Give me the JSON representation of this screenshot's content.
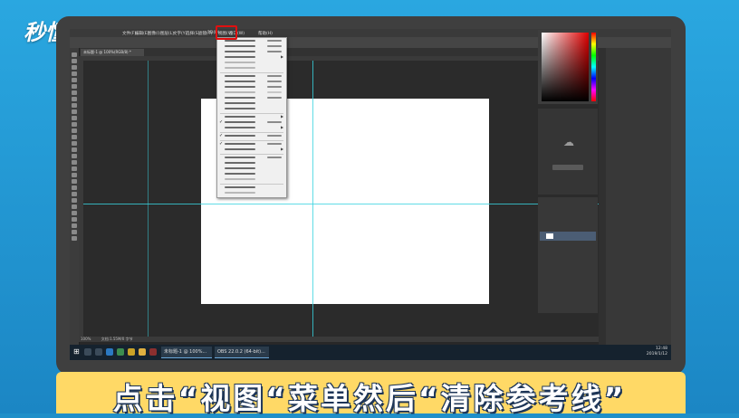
{
  "brand": {
    "logo_text": "秒懂视频"
  },
  "photoshop": {
    "menubar": [
      "文件(F)",
      "编辑(E)",
      "图像(I)",
      "图层(L)",
      "文字(Y)",
      "选择(S)",
      "滤镜(T)",
      "3D(D)",
      "视图(V)",
      "窗口(W)",
      "帮助(H)"
    ],
    "document_tab": "未标题-1 @ 100%(RGB/8) *",
    "status_bar": {
      "zoom": "100%",
      "doc_info": "文档:1.55M/0 字节"
    },
    "view_menu_active": "视图(V)"
  },
  "view_menu": {
    "items": [
      {
        "checked": false,
        "disabled": false,
        "submenu": false,
        "shortcut": true
      },
      {
        "checked": false,
        "disabled": false,
        "submenu": false,
        "shortcut": true
      },
      {
        "checked": false,
        "disabled": false,
        "submenu": false,
        "shortcut": true
      },
      {
        "checked": false,
        "disabled": false,
        "submenu": true,
        "shortcut": false
      },
      {
        "checked": false,
        "disabled": true,
        "submenu": false,
        "shortcut": false
      },
      {
        "checked": false,
        "disabled": true,
        "submenu": false,
        "shortcut": false
      },
      {
        "sep": true
      },
      {
        "checked": false,
        "disabled": false,
        "submenu": false,
        "shortcut": true
      },
      {
        "checked": false,
        "disabled": false,
        "submenu": false,
        "shortcut": true
      },
      {
        "checked": false,
        "disabled": false,
        "submenu": false,
        "shortcut": true
      },
      {
        "checked": false,
        "disabled": true,
        "submenu": false,
        "shortcut": true
      },
      {
        "checked": false,
        "disabled": false,
        "submenu": false,
        "shortcut": true
      },
      {
        "checked": false,
        "disabled": false,
        "submenu": false,
        "shortcut": false
      },
      {
        "checked": false,
        "disabled": false,
        "submenu": false,
        "shortcut": false
      },
      {
        "sep": true
      },
      {
        "checked": false,
        "disabled": false,
        "submenu": true,
        "shortcut": false
      },
      {
        "checked": true,
        "disabled": false,
        "submenu": false,
        "shortcut": true
      },
      {
        "checked": false,
        "disabled": false,
        "submenu": true,
        "shortcut": false
      },
      {
        "sep": true
      },
      {
        "checked": true,
        "disabled": false,
        "submenu": false,
        "shortcut": true
      },
      {
        "sep": true
      },
      {
        "checked": true,
        "disabled": false,
        "submenu": false,
        "shortcut": true
      },
      {
        "checked": false,
        "disabled": false,
        "submenu": true,
        "shortcut": false
      },
      {
        "sep": true
      },
      {
        "checked": false,
        "disabled": false,
        "submenu": false,
        "shortcut": true
      },
      {
        "checked": false,
        "disabled": false,
        "submenu": false,
        "shortcut": false
      },
      {
        "checked": false,
        "disabled": false,
        "submenu": false,
        "shortcut": false
      },
      {
        "checked": false,
        "disabled": false,
        "submenu": false,
        "shortcut": false
      },
      {
        "checked": false,
        "disabled": true,
        "submenu": false,
        "shortcut": false
      },
      {
        "sep": true
      },
      {
        "checked": false,
        "disabled": false,
        "submenu": false,
        "shortcut": false
      },
      {
        "checked": false,
        "disabled": true,
        "submenu": false,
        "shortcut": false
      }
    ]
  },
  "creative_cloud": {
    "button": "立即登录"
  },
  "layers": {
    "layer_name": "背景"
  },
  "taskbar": {
    "apps": [
      "未标题-1 @ 100%...",
      "OBS 22.0.2 (64-bit)..."
    ],
    "time": "12:48",
    "date": "2019/1/12"
  },
  "caption": {
    "text": "点击“视图“菜单然后“清除参考线”"
  },
  "colors": {
    "guide": "#38d3e0",
    "highlight": "#e01010",
    "caption_bg": "#ffd966",
    "outer_bg": "#1f8fc9"
  }
}
